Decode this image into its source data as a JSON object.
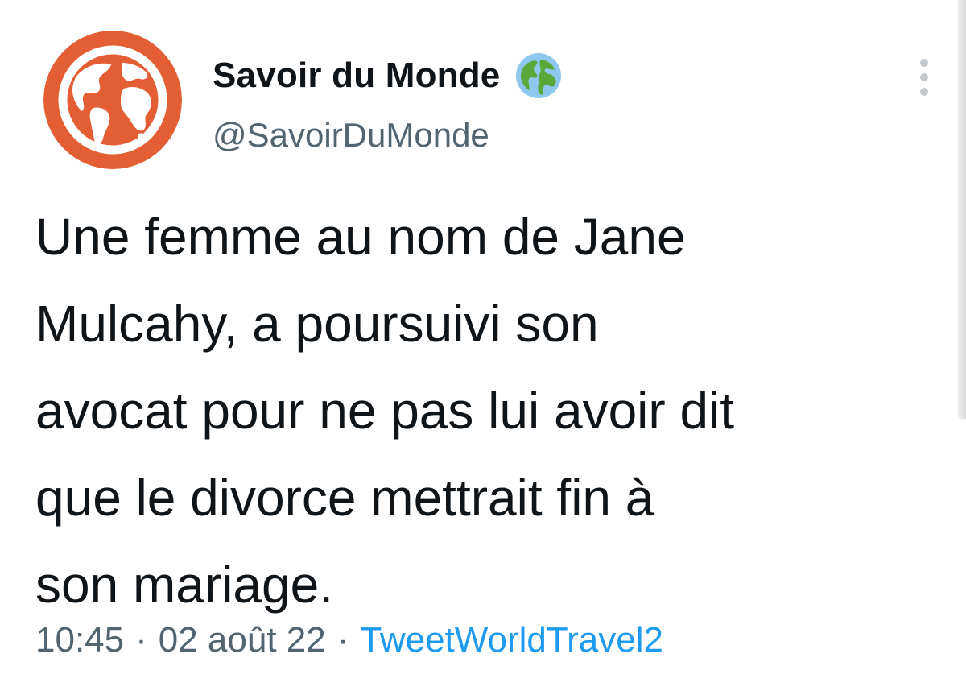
{
  "account": {
    "display_name": "Savoir du Monde",
    "handle": "@SavoirDuMonde",
    "avatar_icon": "globe-logo",
    "avatar_color": "#e45e33",
    "badge_icon": "earth-globe-emoji"
  },
  "tweet": {
    "lines": [
      "Une femme au nom de Jane",
      "Mulcahy, a poursuivi son",
      "avocat pour ne pas lui avoir dit",
      "que le divorce mettrait fin à",
      "son mariage."
    ]
  },
  "meta": {
    "time": "10:45",
    "separator": "·",
    "date": "02 août 22",
    "source": "TweetWorldTravel2"
  },
  "colors": {
    "text": "#0f1419",
    "secondary": "#536471",
    "link": "#1d9bf0"
  }
}
